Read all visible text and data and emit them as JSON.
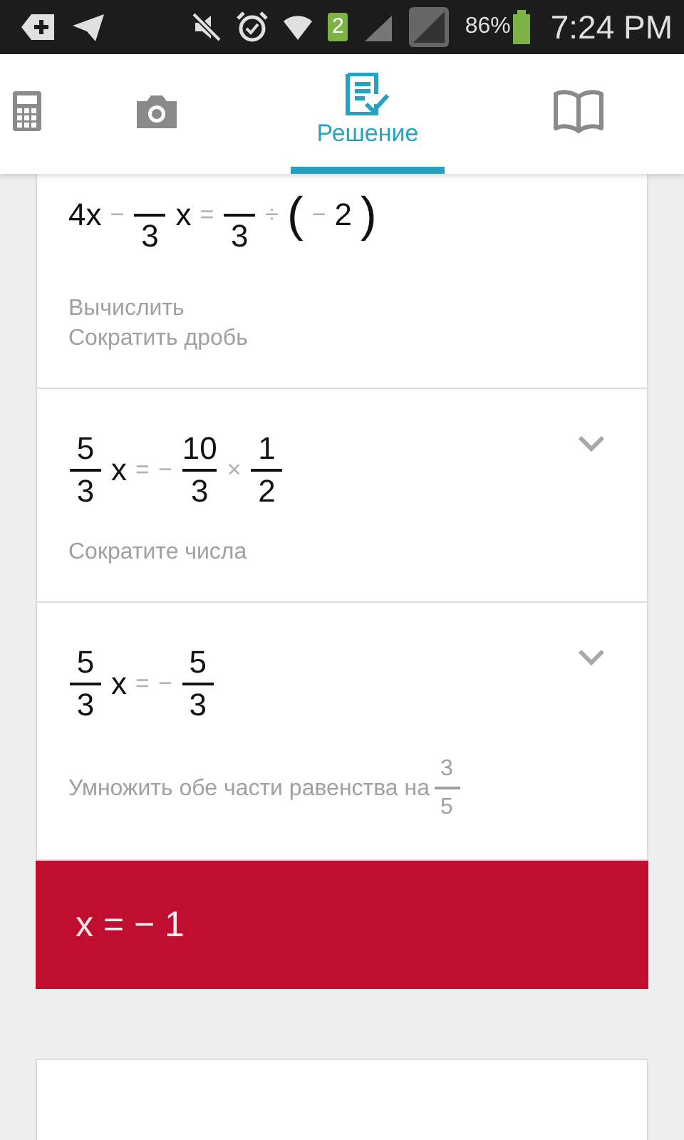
{
  "status_bar": {
    "battery": "86%",
    "time": "7:24 PM",
    "sim_badge": "2"
  },
  "tabs": [
    {
      "kind": "calculator",
      "selected": false
    },
    {
      "kind": "camera",
      "selected": false
    },
    {
      "kind": "solution",
      "label": "Решение",
      "selected": true
    },
    {
      "kind": "book",
      "selected": false
    }
  ],
  "steps": [
    {
      "collapsible": false,
      "expression": [
        {
          "kind": "term",
          "text": "4x"
        },
        {
          "kind": "op",
          "text": "−"
        },
        {
          "kind": "frac",
          "den": "3"
        },
        {
          "kind": "term",
          "text": "x"
        },
        {
          "kind": "op",
          "text": "="
        },
        {
          "kind": "frac",
          "den": "3"
        },
        {
          "kind": "op",
          "text": "÷"
        },
        {
          "kind": "paren",
          "text": "("
        },
        {
          "kind": "op",
          "text": "−"
        },
        {
          "kind": "term",
          "text": "2"
        },
        {
          "kind": "paren",
          "text": ")"
        }
      ],
      "hints": [
        [
          {
            "kind": "text",
            "text": "Вычислить"
          }
        ],
        [
          {
            "kind": "text",
            "text": "Сократить дробь"
          }
        ]
      ]
    },
    {
      "collapsible": true,
      "expression": [
        {
          "kind": "frac",
          "num": "5",
          "den": "3"
        },
        {
          "kind": "term",
          "text": "x"
        },
        {
          "kind": "op",
          "text": "="
        },
        {
          "kind": "op",
          "text": "−"
        },
        {
          "kind": "frac",
          "num": "10",
          "den": "3"
        },
        {
          "kind": "op",
          "text": "×"
        },
        {
          "kind": "frac",
          "num": "1",
          "den": "2"
        }
      ],
      "hints": [
        [
          {
            "kind": "text",
            "text": "Сократите числа"
          }
        ]
      ]
    },
    {
      "collapsible": true,
      "expression": [
        {
          "kind": "frac",
          "num": "5",
          "den": "3"
        },
        {
          "kind": "term",
          "text": "x"
        },
        {
          "kind": "op",
          "text": "="
        },
        {
          "kind": "op",
          "text": "−"
        },
        {
          "kind": "frac",
          "num": "5",
          "den": "3"
        }
      ],
      "hints": [
        [
          {
            "kind": "text",
            "text": "Умножить обе части равенства на"
          },
          {
            "kind": "frac",
            "num": "3",
            "den": "5"
          }
        ]
      ]
    }
  ],
  "answer": "x = − 1"
}
